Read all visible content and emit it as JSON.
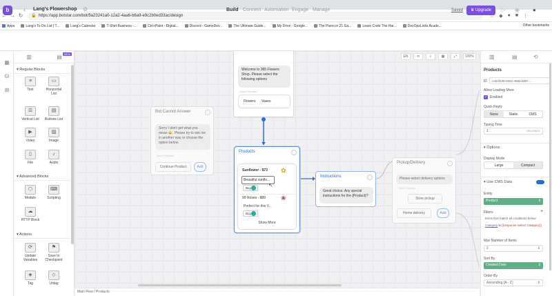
{
  "browser": {
    "url": "https://app.botstar.com/bot/5a23241a0-12a2-4aa6-b6a9-e9c2b0ed33ac/design",
    "apps_label": "Apps",
    "bookmarks": [
      "Lang's To Do List | T...",
      "Lang's Calendar",
      "T-Shirt Business -...",
      "Ctrl+Paint - Digital...",
      "Discord - GameDev...",
      "The Ultimate Guide...",
      "My Drive - Google...",
      "The Piano in 21 Ga...",
      "Learn Code The Har...",
      "DevOpsLinks Acade..."
    ],
    "other_bookmarks": "Other bookmarks"
  },
  "header": {
    "project_name": "Lang's Flowershop",
    "tabs": [
      "Build",
      "Connect",
      "Automation",
      "Engage",
      "Manage"
    ],
    "active_tab": "Build",
    "saved_label": "Saved",
    "upgrade_label": "Upgrade"
  },
  "panel": {
    "new_tag": "NEW",
    "regular_header": "Regular Blocks",
    "regular_blocks": [
      "Text",
      "Horizontal List",
      "Vertical List",
      "Buttons List",
      "Video",
      "Image",
      "File",
      "Audio"
    ],
    "advanced_header": "Advanced Blocks",
    "advanced_blocks": [
      "Module",
      "Scripting",
      "HTTP Block"
    ],
    "actions_header": "Actions",
    "actions": [
      "Update Variables",
      "Save to Checkpoint",
      "Tag",
      "Untag"
    ]
  },
  "canvas": {
    "toolbar": [
      "EN",
      "",
      "",
      "",
      "",
      "100%",
      ""
    ],
    "welcome": {
      "text": "Welcome to 365 Flowers Shop. Please select the following options",
      "quick_replies_label": "Quick Replies",
      "buttons": [
        "Flowers",
        "Vases"
      ]
    },
    "bot_cannot_answer": {
      "title": "Bot Cannot Answer",
      "text": "Sorry I don't get what you mean 😀. Please try to ask me in another way or choose the option below.",
      "quick_replies_label": "Quick Replies",
      "button": "Continue Product",
      "add": "Add"
    },
    "products": {
      "title": "Products",
      "item1_title": "Sunflower - $73",
      "item1_desc": "Beautiful sunflo...",
      "item1_btn": "Buy",
      "item2_title": "99 Roses - $89",
      "item2_desc": "Perfect for this V...",
      "item2_btn": "Buy",
      "show_more": "Show More"
    },
    "instructions": {
      "title": "Instructions",
      "text": "Great choice. Any special instructions for the {Product}?"
    },
    "pickup": {
      "title": "Pickup/Delivery",
      "text": "Please select delivery options",
      "quick_replies_label": "Quick Replies",
      "btn1": "Store pickup",
      "btn2": "Home delivery",
      "add": "Add"
    }
  },
  "right_panel": {
    "title": "Products",
    "id_label": "ID",
    "id_value": "c254f339-0282-458a-b6f0-...",
    "allow_loading_more": "Allow Loading More",
    "enabled": "Enabled",
    "quick_reply": "Quick Reply",
    "qr_options": [
      "None",
      "Static",
      "CMS"
    ],
    "typing_time": "Typing Time",
    "typing_value": "1",
    "typing_unit": "SECONDS",
    "options_header": "Options",
    "display_mode": "Display Mode",
    "display_options": [
      "Large",
      "Compact"
    ],
    "use_cms": "Use CMS Data",
    "entity_label": "Entity",
    "entity_value": "Product",
    "filters_label": "Filters",
    "filters_text": "Items that match all conditions below:",
    "filter_condition_a": "Category",
    "filter_condition_b": "is",
    "filter_condition_c": "{{response.Select Category}}",
    "max_items_label": "Max Number of Items",
    "max_items_value": "2",
    "sort_by_label": "Sort By",
    "sort_by_value": "Created Date",
    "order_by_label": "Order By",
    "order_by_value": "Ascending (A - Z)"
  },
  "footer": {
    "breadcrumb": [
      "Main Flow",
      "Products"
    ]
  }
}
